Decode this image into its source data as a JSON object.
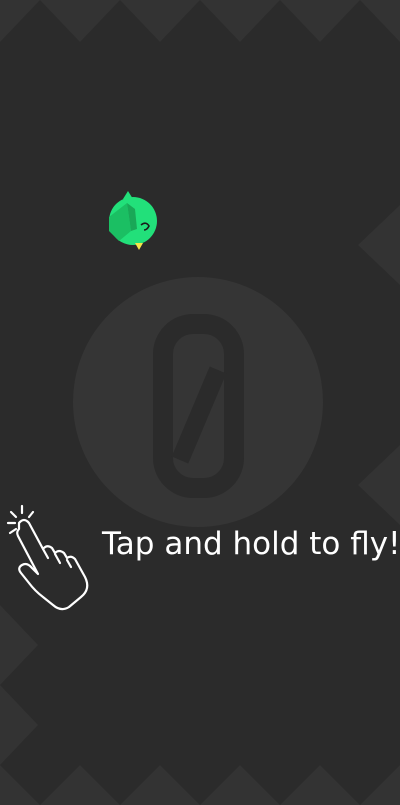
{
  "game": {
    "score": "0",
    "hint": "Tap and hold to fly!",
    "colors": {
      "background": "#2b2b2b",
      "spikes": "#333333",
      "score_circle": "#353535",
      "score_digit": "#2b2b2b",
      "bird_body": "#22e07a",
      "bird_wing": "#1bbf63",
      "bird_beak": "#f4e64a",
      "hint_text": "#ffffff"
    },
    "icons": {
      "hint_icon": "tap-hand-icon",
      "player": "bird-icon"
    }
  }
}
